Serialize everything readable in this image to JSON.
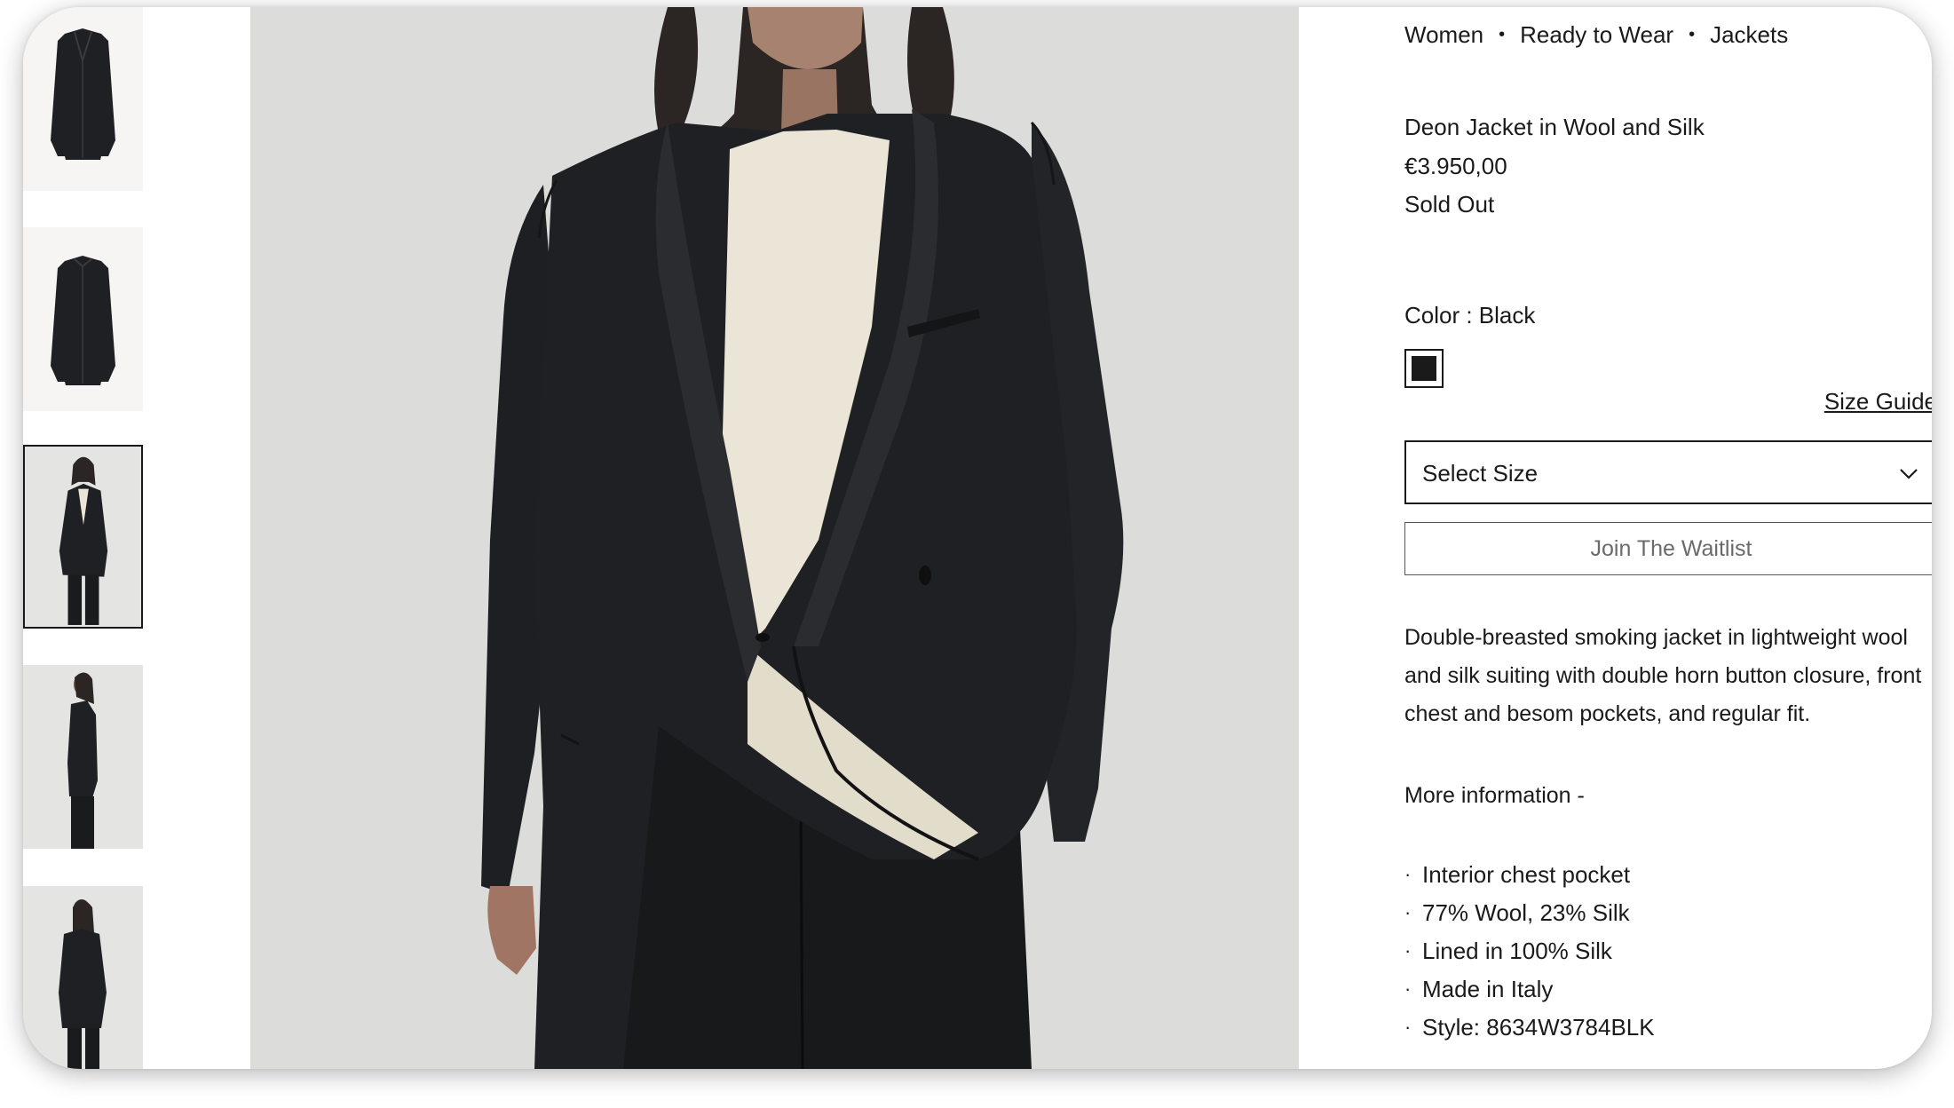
{
  "breadcrumb": [
    "Women",
    "Ready to Wear",
    "Jackets"
  ],
  "product": {
    "name": "Deon Jacket in Wool and Silk",
    "price": "€3.950,00",
    "availability": "Sold Out"
  },
  "color": {
    "label": "Color : Black",
    "swatch_hex": "#1a1a1a"
  },
  "size": {
    "guide_label": "Size Guide",
    "select_label": "Select Size",
    "chevron_icon": "chevron-down-icon"
  },
  "waitlist_label": "Join The Waitlist",
  "description": "Double-breasted smoking jacket in lightweight wool and silk suiting with double horn button closure, front chest and besom pockets, and regular fit.",
  "more_info_label": "More information  -",
  "details": [
    "Interior chest pocket",
    "77% Wool, 23% Silk",
    "Lined in 100% Silk",
    "Made in Italy",
    "Style: 8634W3784BLK"
  ],
  "gallery": {
    "thumbnails": [
      "jacket front flat",
      "jacket back flat",
      "model front",
      "model side",
      "model back"
    ],
    "selected_index": 2
  },
  "colors": {
    "jacket": "#1f2023",
    "blouse": "#eae5d6",
    "backdrop": "#dcdcdb",
    "text": "#1a1a1a"
  }
}
